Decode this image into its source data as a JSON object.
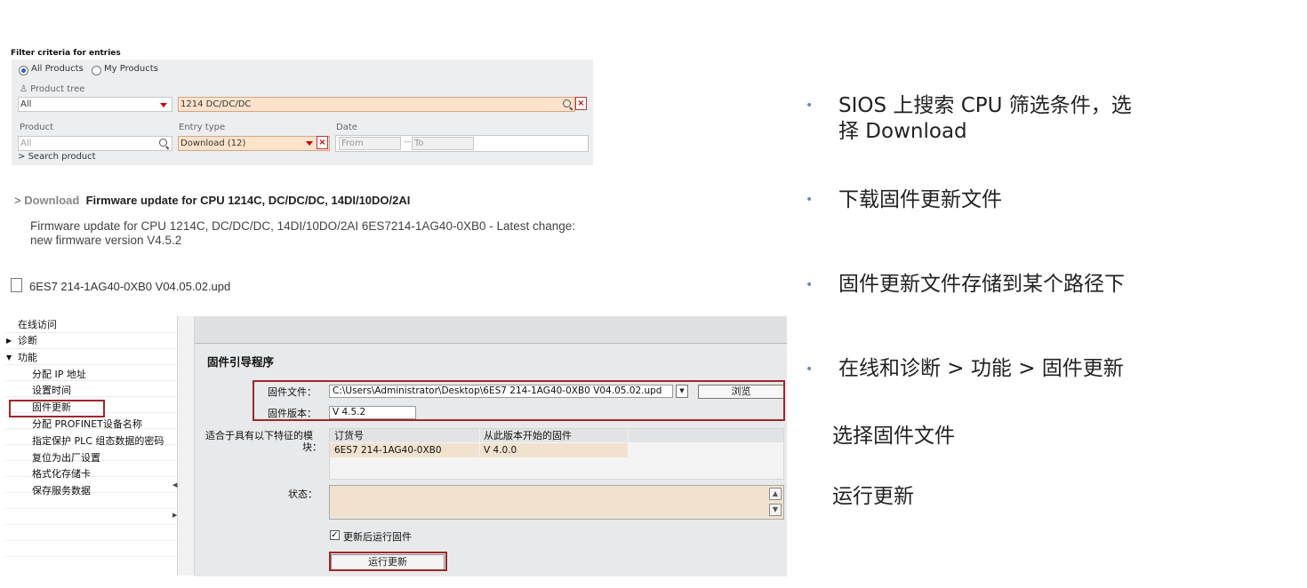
{
  "filter": {
    "title": "Filter criteria for entries",
    "radio_all": "All Products",
    "radio_my": "My Products",
    "product_tree_label": "Product tree",
    "product_tree_value": "All",
    "search_value": "1214 DC/DC/DC",
    "product_label": "Product",
    "product_placeholder": "All",
    "entry_type_label": "Entry type",
    "entry_type_value": "Download (12)",
    "date_label": "Date",
    "date_from": "From",
    "date_to": "To",
    "search_product": "Search product"
  },
  "download": {
    "chevron": ">",
    "type": "Download",
    "title": "Firmware update for CPU 1214C, DC/DC/DC, 14DI/10DO/2AI",
    "description": "Firmware update for CPU 1214C, DC/DC/DC, 14DI/10DO/2AI 6ES7214-1AG40-0XB0 - Latest change: new firmware version V4.5.2",
    "file_name": "6ES7 214-1AG40-0XB0 V04.05.02.upd"
  },
  "tree": {
    "items": [
      "在线访问",
      "诊断",
      "功能",
      "分配 IP 地址",
      "设置时间",
      "固件更新",
      "分配 PROFINET设备名称",
      "指定保护 PLC 组态数据的密码",
      "复位为出厂设置",
      "格式化存储卡",
      "保存服务数据"
    ]
  },
  "firmware": {
    "section_title": "固件引导程序",
    "file_label": "固件文件：",
    "file_path": "C:\\Users\\Administrator\\Desktop\\6ES7 214-1AG40-0XB0 V04.05.02.upd",
    "browse": "浏览",
    "version_label": "固件版本：",
    "version_value": "V 4.5.2",
    "module_label_1": "适合于具有以下特征的模",
    "module_label_2": "块：",
    "col_order": "订货号",
    "col_fw": "从此版本开始的固件",
    "row_order": "6ES7 214-1AG40-0XB0",
    "row_fw": "V 4.0.0",
    "status_label": "状态：",
    "checkbox_label": "更新后运行固件",
    "run_button": "运行更新"
  },
  "bullets": {
    "b1_line1": "SIOS 上搜索 CPU 筛选条件，选",
    "b1_line2": "择 Download",
    "b2": "下载固件更新文件",
    "b3": "固件更新文件存储到某个路径下",
    "b4": "在线和诊断 > 功能 > 固件更新",
    "s1": "选择固件文件",
    "s2": "运行更新"
  },
  "colors": {
    "highlight_red": "#a0262a",
    "bullet_blue": "#5a8fc7",
    "field_highlight": "#fde3cc"
  }
}
